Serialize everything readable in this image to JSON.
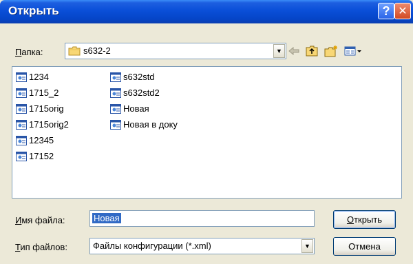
{
  "window": {
    "title": "Открыть"
  },
  "titlebar_buttons": {
    "help": "?",
    "close": "✕"
  },
  "folder": {
    "label_rest": "апка:",
    "label_accel": "П",
    "current": "s632-2"
  },
  "files": [
    {
      "name": "1234"
    },
    {
      "name": "1715_2"
    },
    {
      "name": "1715orig"
    },
    {
      "name": "1715orig2"
    },
    {
      "name": "12345"
    },
    {
      "name": "17152"
    },
    {
      "name": "s632std"
    },
    {
      "name": "s632std2"
    },
    {
      "name": "Новая"
    },
    {
      "name": "Новая в доку"
    }
  ],
  "filename": {
    "label_accel": "И",
    "label_rest": "мя файла:",
    "value": "Новая"
  },
  "filetype": {
    "label_accel": "Т",
    "label_rest": "ип файлов:",
    "value": "Файлы конфигурации (*.xml)"
  },
  "buttons": {
    "open_accel": "О",
    "open_rest": "ткрыть",
    "cancel": "Отмена"
  },
  "icons": [
    "folder-icon",
    "back-icon",
    "up-folder-icon",
    "new-folder-icon",
    "view-menu-icon",
    "xml-file-icon"
  ]
}
